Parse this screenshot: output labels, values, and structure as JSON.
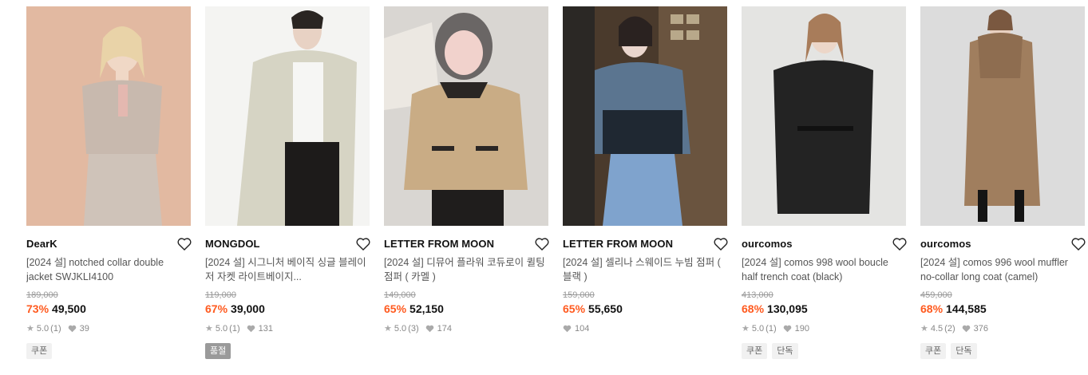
{
  "products": [
    {
      "brand": "DearK",
      "title": "[2024 설] notched collar double jacket SWJKLI4100",
      "original_price": "189,000",
      "discount": "73%",
      "price": "49,500",
      "rating": "5.0",
      "reviews": "(1)",
      "likes": "39",
      "tags": [
        "쿠폰"
      ],
      "bg_color": "#e2b9a1"
    },
    {
      "brand": "MONGDOL",
      "title": "[2024 설] 시그니처 베이직 싱글 블레이저 자켓 라이트베이지...",
      "original_price": "119,000",
      "discount": "67%",
      "price": "39,000",
      "rating": "5.0",
      "reviews": "(1)",
      "likes": "131",
      "tags": [
        "품절"
      ],
      "bg_color": "#f4f4f2"
    },
    {
      "brand": "LETTER FROM MOON",
      "title": "[2024 설] 디뮤어 플라워 코듀로이 퀼팅 점퍼 ( 카멜 )",
      "original_price": "149,000",
      "discount": "65%",
      "price": "52,150",
      "rating": "5.0",
      "reviews": "(3)",
      "likes": "174",
      "tags": [],
      "bg_color": "#d9d6d2"
    },
    {
      "brand": "LETTER FROM MOON",
      "title": "[2024 설] 셀리나 스웨이드 누빔 점퍼 ( 블랙 )",
      "original_price": "159,000",
      "discount": "65%",
      "price": "55,650",
      "rating": "",
      "reviews": "",
      "likes": "104",
      "tags": [],
      "bg_color": "#4a3a2c"
    },
    {
      "brand": "ourcomos",
      "title": "[2024 설] comos 998 wool boucle half trench coat (black)",
      "original_price": "413,000",
      "discount": "68%",
      "price": "130,095",
      "rating": "5.0",
      "reviews": "(1)",
      "likes": "190",
      "tags": [
        "쿠폰",
        "단독"
      ],
      "bg_color": "#e4e4e2"
    },
    {
      "brand": "ourcomos",
      "title": "[2024 설] comos 996 wool muffler no-collar long coat (camel)",
      "original_price": "459,000",
      "discount": "68%",
      "price": "144,585",
      "rating": "4.5",
      "reviews": "(2)",
      "likes": "376",
      "tags": [
        "쿠폰",
        "단독"
      ],
      "bg_color": "#dcdcdc"
    }
  ],
  "icons": {
    "wishlist": "heart-outline-icon",
    "rating": "star-icon",
    "likes": "heart-filled-icon"
  },
  "colors": {
    "discount": "#ff5a1f",
    "tag_bg": "#f1f1f1",
    "sold_tag_bg": "#9a9a9a"
  }
}
